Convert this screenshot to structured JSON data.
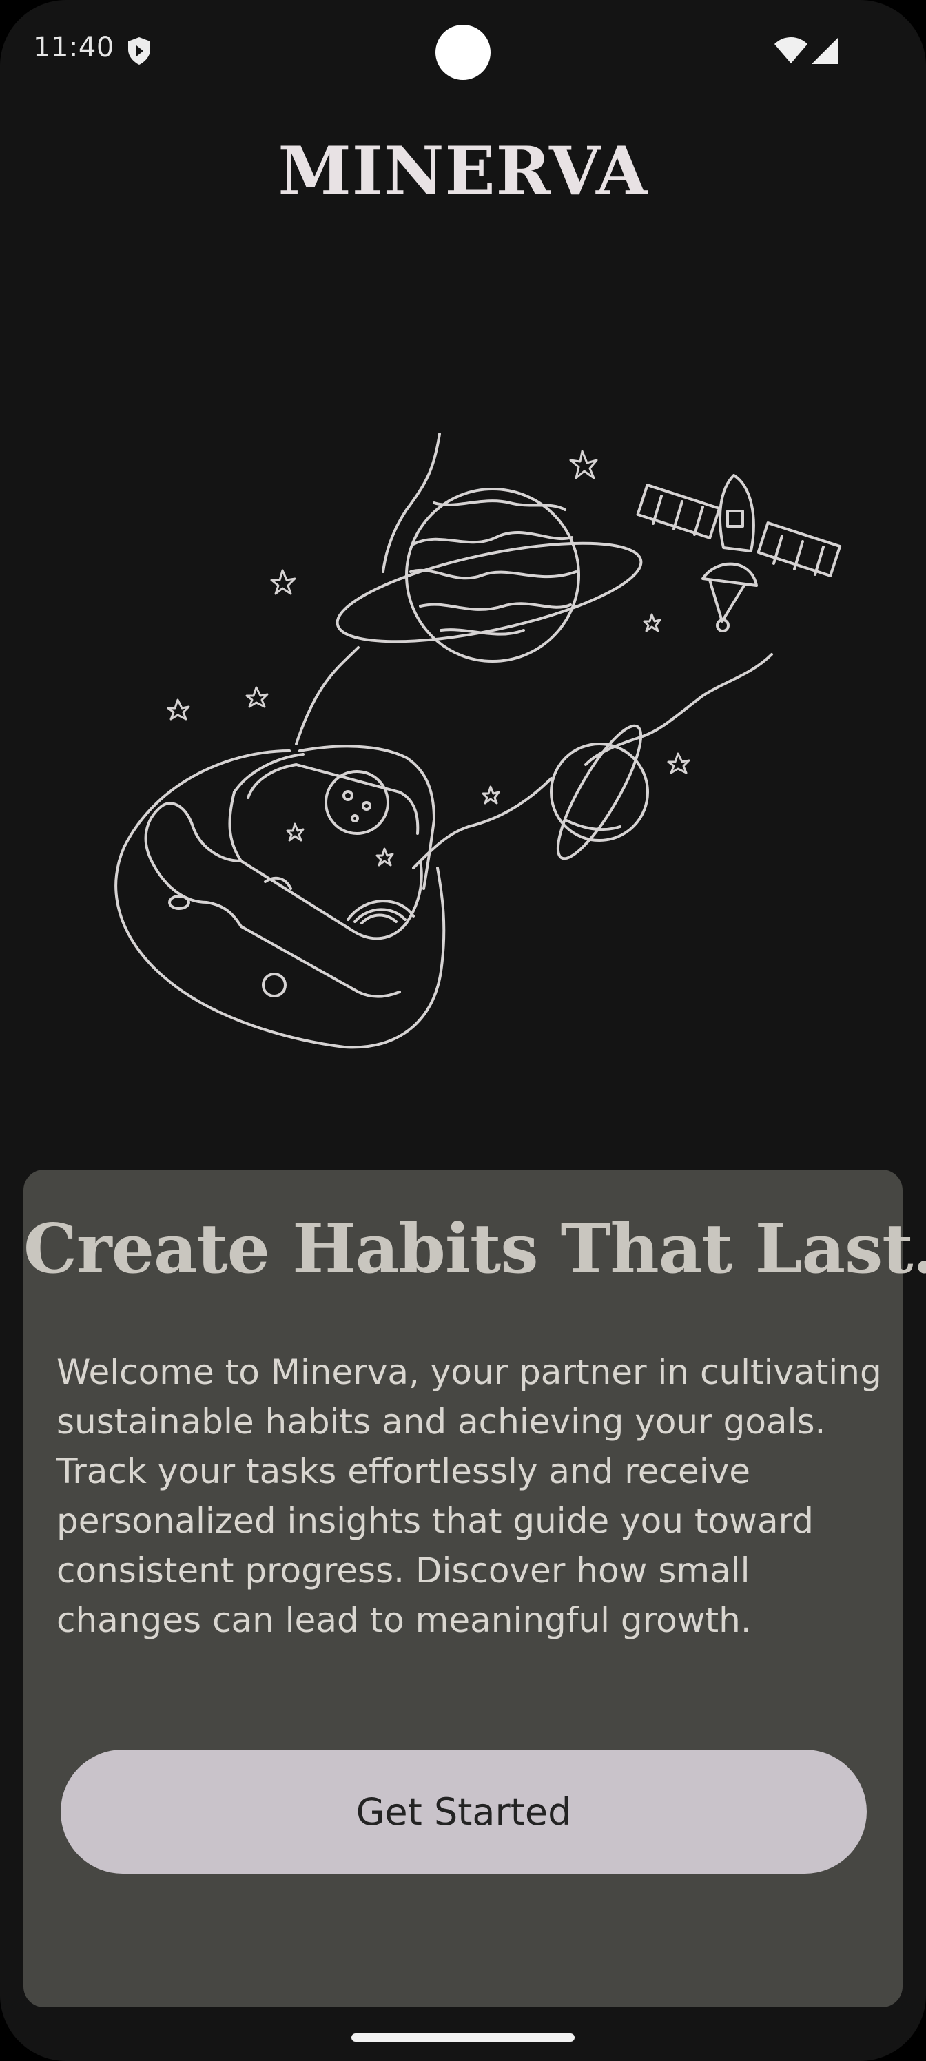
{
  "status_bar": {
    "time": "11:40",
    "icons": [
      "shield-icon",
      "wifi-icon",
      "cellular-signal-icon"
    ]
  },
  "app": {
    "title": "MINERVA"
  },
  "illustration": {
    "subject": "space-illustration",
    "stroke_color": "#d6d3d3"
  },
  "card": {
    "title": "Create Habits That Last.",
    "body": "Welcome to Minerva, your partner in cultivating sustainable habits and achieving your goals. Track your tasks effortlessly and receive personalized insights that guide you toward consistent progress. Discover how small changes can lead to meaningful growth.",
    "button_label": "Get Started"
  },
  "colors": {
    "background": "#141414",
    "card": "#474743",
    "button": "#c9c3ca",
    "title_text": "#e8e2e4",
    "card_title_text": "#c9c6bf"
  }
}
